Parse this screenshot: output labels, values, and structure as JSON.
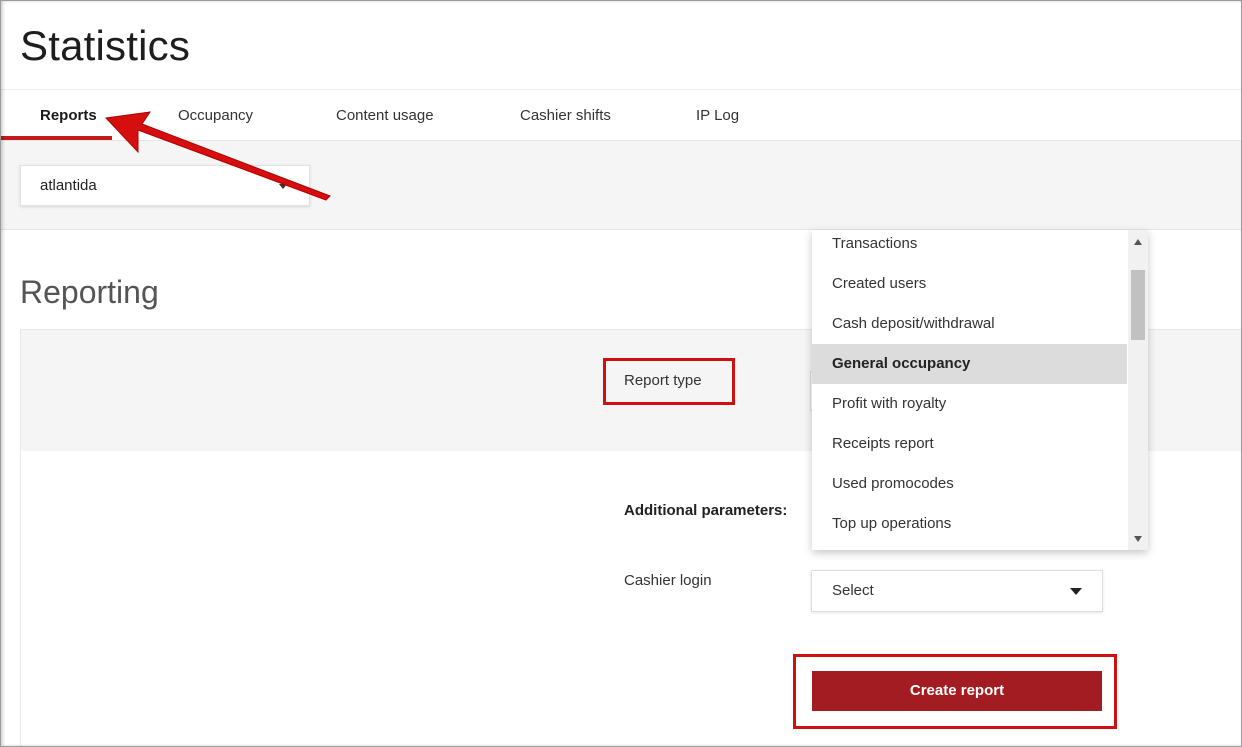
{
  "page": {
    "title": "Statistics"
  },
  "tabs": [
    {
      "label": "Reports",
      "active": true
    },
    {
      "label": "Occupancy",
      "active": false
    },
    {
      "label": "Content usage",
      "active": false
    },
    {
      "label": "Cashier shifts",
      "active": false
    },
    {
      "label": "IP Log",
      "active": false
    }
  ],
  "club_select": {
    "value": "atlantida"
  },
  "reporting": {
    "title": "Reporting",
    "report_type_label": "Report type",
    "additional_label": "Additional parameters:",
    "cashier_login_label": "Cashier login",
    "cashier_select_value": "Select",
    "create_button": "Create report"
  },
  "report_type_dropdown": {
    "selected": "General occupancy",
    "options": [
      "Transactions",
      "Created users",
      "Cash deposit/withdrawal",
      "General occupancy",
      "Profit with royalty",
      "Receipts report",
      "Used promocodes",
      "Top up operations"
    ]
  },
  "colors": {
    "accent": "#a31c22",
    "annotation": "#d01010",
    "active_tab_underline": "#c21b1b"
  }
}
